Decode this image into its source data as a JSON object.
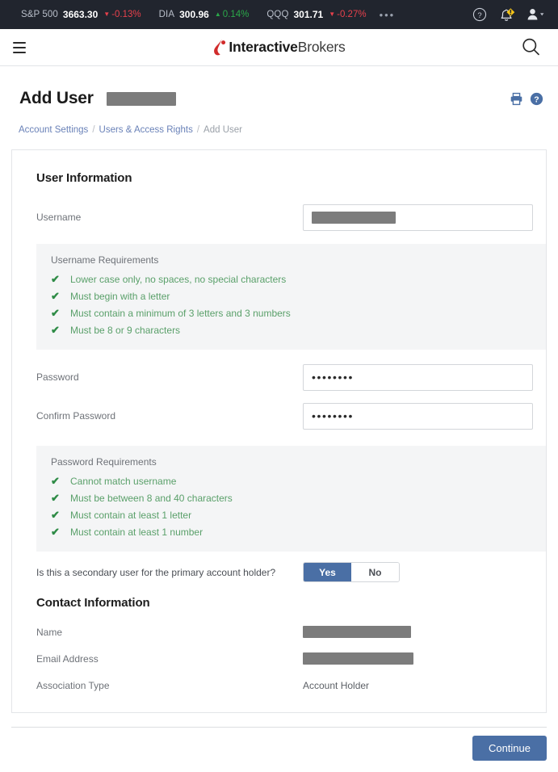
{
  "ticker_bar": {
    "tickers": [
      {
        "symbol": "S&P 500",
        "price": "3663.30",
        "change": "-0.13%",
        "direction": "down",
        "arrow": "▼"
      },
      {
        "symbol": "DIA",
        "price": "300.96",
        "change": "0.14%",
        "direction": "up",
        "arrow": "▲"
      },
      {
        "symbol": "QQQ",
        "price": "301.71",
        "change": "-0.27%",
        "direction": "down",
        "arrow": "▼"
      }
    ],
    "more_label": "•••",
    "icons": [
      "help-circle-icon",
      "notification-bell-alert-icon",
      "user-account-icon"
    ]
  },
  "masthead": {
    "menu_icon": "hamburger-menu-icon",
    "logo_bold": "Interactive",
    "logo_light": "Brokers",
    "logo_mark": "ib-flame-logo",
    "search_icon": "search-icon"
  },
  "page": {
    "title": "Add User",
    "print_icon": "print-icon",
    "help_icon": "help-icon"
  },
  "breadcrumb": {
    "items": [
      {
        "label": "Account Settings",
        "current": false
      },
      {
        "label": "Users & Access Rights",
        "current": false
      },
      {
        "label": "Add User",
        "current": true
      }
    ],
    "separator": "/"
  },
  "user_information": {
    "heading": "User Information",
    "username_label": "Username",
    "username_value": "",
    "username_requirements": {
      "title": "Username Requirements",
      "items": [
        "Lower case only, no spaces, no special characters",
        "Must begin with a letter",
        "Must contain a minimum of 3 letters and 3 numbers",
        "Must be 8 or 9 characters"
      ]
    },
    "password_label": "Password",
    "password_value": "••••••••",
    "confirm_password_label": "Confirm Password",
    "confirm_password_value": "••••••••",
    "password_requirements": {
      "title": "Password Requirements",
      "items": [
        "Cannot match username",
        "Must be between 8 and 40 characters",
        "Must contain at least 1 letter",
        "Must contain at least 1 number"
      ]
    },
    "secondary_user_question": "Is this a secondary user for the primary account holder?",
    "secondary_user_options": [
      {
        "label": "Yes",
        "selected": true
      },
      {
        "label": "No",
        "selected": false
      }
    ]
  },
  "contact_information": {
    "heading": "Contact Information",
    "name_label": "Name",
    "name_value": "",
    "email_label": "Email Address",
    "email_value": "",
    "association_type_label": "Association Type",
    "association_type_value": "Account Holder"
  },
  "footer": {
    "continue_label": "Continue"
  },
  "colors": {
    "ticker_bar_bg": "#21252e",
    "accent_blue": "#4a6fa5",
    "link_blue": "#6a82b8",
    "success_green": "#5aa06a",
    "check_green": "#2e8b46",
    "brand_red": "#d12b2b",
    "panel_gray": "#f4f5f6",
    "redaction_gray": "#7c7c7c",
    "badge_yellow": "#f5c518"
  },
  "icons": {
    "check": "✔"
  }
}
